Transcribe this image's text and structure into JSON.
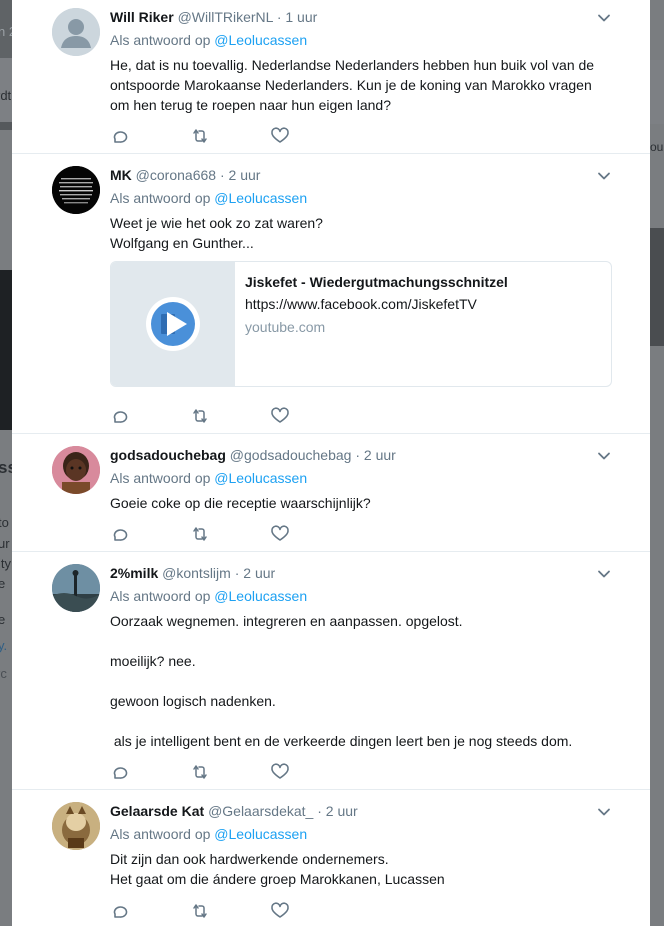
{
  "tweets": [
    {
      "name": "Will Riker",
      "handle": "@WillTRikerNL",
      "time": "1 uur",
      "reply_prefix": "Als antwoord op",
      "reply_to": "@Leolucassen",
      "lines": [
        "He, dat is nu toevallig. Nederlandse Nederlanders hebben hun buik vol van de",
        "ontspoorde Marokaanse Nederlanders. Kun je de koning van Marokko vragen",
        "om hen terug te roepen naar hun eigen land?"
      ]
    },
    {
      "name": "MK",
      "handle": "@corona668",
      "time": "2 uur",
      "reply_prefix": "Als antwoord op",
      "reply_to": "@Leolucassen",
      "lines": [
        "Weet je wie het ook zo zat waren?",
        "Wolfgang en Gunther..."
      ],
      "card": {
        "title": "Jiskefet - Wiedergutmachungsschnitzel",
        "description": "https://www.facebook.com/JiskefetTV",
        "domain": "youtube.com"
      }
    },
    {
      "name": "godsadouchebag",
      "handle": "@godsadouchebag",
      "time": "2 uur",
      "reply_prefix": "Als antwoord op",
      "reply_to": "@Leolucassen",
      "lines": [
        "Goeie coke op die receptie waarschijnlijk?"
      ]
    },
    {
      "name": "2%milk",
      "handle": "@kontslijm",
      "time": "2 uur",
      "reply_prefix": "Als antwoord op",
      "reply_to": "@Leolucassen",
      "lines": [
        "Oorzaak wegnemen. integreren en aanpassen. opgelost.",
        "",
        "moeilijk? nee.",
        "",
        "gewoon logisch nadenken.",
        "",
        " als je intelligent bent en de verkeerde dingen leert ben je nog steeds dom."
      ]
    },
    {
      "name": "Gelaarsde Kat",
      "handle": "@Gelaarsdekat_",
      "time": "2 uur",
      "reply_prefix": "Als antwoord op",
      "reply_to": "@Leolucassen",
      "lines": [
        "Dit zijn dan ook hardwerkende ondernemers.",
        "Het gaat om die ándere groep Marokkanen, Lucassen"
      ]
    }
  ],
  "background_fragments": {
    "left": [
      "n 2",
      "rdt",
      "ss",
      "to",
      "ur",
      "ity",
      "e",
      "e",
      "y.",
      "rc"
    ],
    "right": [
      "oun"
    ]
  },
  "colors": {
    "link": "#1da1f2",
    "muted": "#657786",
    "text": "#14171a",
    "divider": "#e6ecf0",
    "overlay": "#6b6e71"
  },
  "icons": {
    "reply": "reply-icon",
    "retweet": "retweet-icon",
    "like": "heart-icon",
    "caret": "chevron-down-icon",
    "play": "play-icon"
  }
}
